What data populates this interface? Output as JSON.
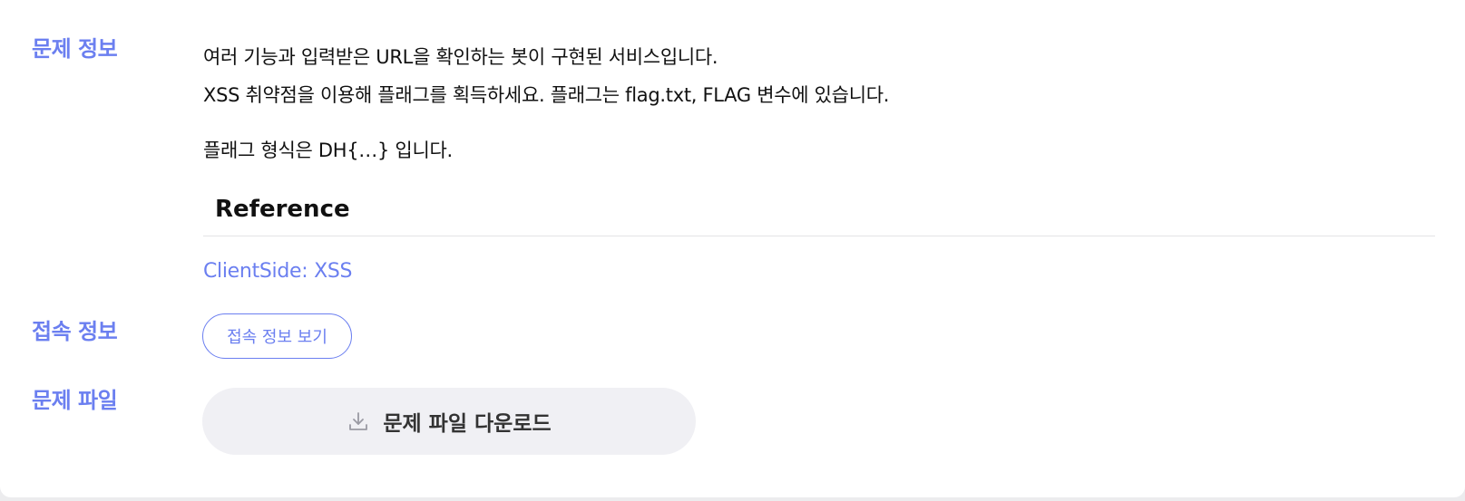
{
  "labels": {
    "problem_info": "문제 정보",
    "access_info": "접속 정보",
    "problem_file": "문제 파일"
  },
  "description": {
    "line1": "여러 기능과 입력받은 URL을 확인하는 봇이 구현된 서비스입니다.",
    "line2": "XSS 취약점을 이용해 플래그를 획득하세요. 플래그는 flag.txt, FLAG 변수에 있습니다.",
    "line3": "플래그 형식은 DH{…} 입니다."
  },
  "reference": {
    "heading": "Reference",
    "link_text": "ClientSide: XSS"
  },
  "buttons": {
    "access_label": "접속 정보 보기",
    "download_label": "문제 파일 다운로드"
  },
  "icons": {
    "download": "download-icon"
  },
  "colors": {
    "accent": "#6b7ff0",
    "text": "#111111",
    "button_bg": "#f0f0f4"
  }
}
